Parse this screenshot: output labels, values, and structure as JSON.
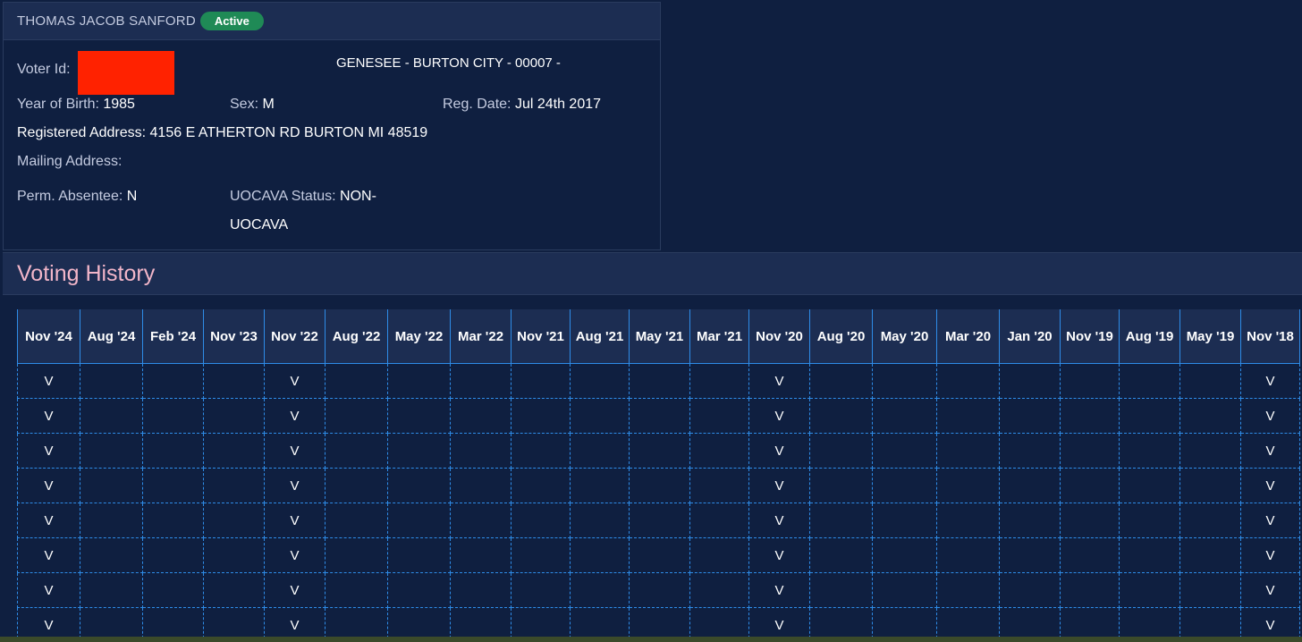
{
  "voter": {
    "name": "THOMAS JACOB SANFORD",
    "status": "Active",
    "voter_id_label": "Voter Id:",
    "jurisdiction": "GENESEE - BURTON CITY - 00007 -",
    "year_of_birth_label": "Year of Birth:",
    "year_of_birth": "1985",
    "sex_label": "Sex:",
    "sex": "M",
    "reg_date_label": "Reg. Date:",
    "reg_date": "Jul 24th 2017",
    "registered_address_label": "Registered Address:",
    "registered_address": "4156 E ATHERTON RD BURTON MI 48519",
    "mailing_address_label": "Mailing Address:",
    "perm_absentee_label": "Perm. Absentee:",
    "perm_absentee": "N",
    "uocava_label": "UOCAVA Status:",
    "uocava_line1": "NON-",
    "uocava_line2": "UOCAVA"
  },
  "voting_history": {
    "title": "Voting History",
    "columns": [
      "Nov '24",
      "Aug '24",
      "Feb '24",
      "Nov '23",
      "Nov '22",
      "Aug '22",
      "May '22",
      "Mar '22",
      "Nov '21",
      "Aug '21",
      "May '21",
      "Mar '21",
      "Nov '20",
      "Aug '20",
      "May '20",
      "Mar '20",
      "Jan '20",
      "Nov '19",
      "Aug '19",
      "May '19",
      "Nov '18"
    ],
    "rows": [
      [
        "V",
        "",
        "",
        "",
        "V",
        "",
        "",
        "",
        "",
        "",
        "",
        "",
        "V",
        "",
        "",
        "",
        "",
        "",
        "",
        "",
        "V"
      ],
      [
        "V",
        "",
        "",
        "",
        "V",
        "",
        "",
        "",
        "",
        "",
        "",
        "",
        "V",
        "",
        "",
        "",
        "",
        "",
        "",
        "",
        "V"
      ],
      [
        "V",
        "",
        "",
        "",
        "V",
        "",
        "",
        "",
        "",
        "",
        "",
        "",
        "V",
        "",
        "",
        "",
        "",
        "",
        "",
        "",
        "V"
      ],
      [
        "V",
        "",
        "",
        "",
        "V",
        "",
        "",
        "",
        "",
        "",
        "",
        "",
        "V",
        "",
        "",
        "",
        "",
        "",
        "",
        "",
        "V"
      ],
      [
        "V",
        "",
        "",
        "",
        "V",
        "",
        "",
        "",
        "",
        "",
        "",
        "",
        "V",
        "",
        "",
        "",
        "",
        "",
        "",
        "",
        "V"
      ],
      [
        "V",
        "",
        "",
        "",
        "V",
        "",
        "",
        "",
        "",
        "",
        "",
        "",
        "V",
        "",
        "",
        "",
        "",
        "",
        "",
        "",
        "V"
      ],
      [
        "V",
        "",
        "",
        "",
        "V",
        "",
        "",
        "",
        "",
        "",
        "",
        "",
        "V",
        "",
        "",
        "",
        "",
        "",
        "",
        "",
        "V"
      ],
      [
        "V",
        "",
        "",
        "",
        "V",
        "",
        "",
        "",
        "",
        "",
        "",
        "",
        "V",
        "",
        "",
        "",
        "",
        "",
        "",
        "",
        "V"
      ]
    ]
  },
  "colors": {
    "background": "#0f1f40",
    "header": "#1c2d52",
    "active_badge": "#1f8a56",
    "title_pink": "#f2b6c9",
    "grid_blue": "#2e8ce8",
    "redaction": "#ff2200"
  }
}
